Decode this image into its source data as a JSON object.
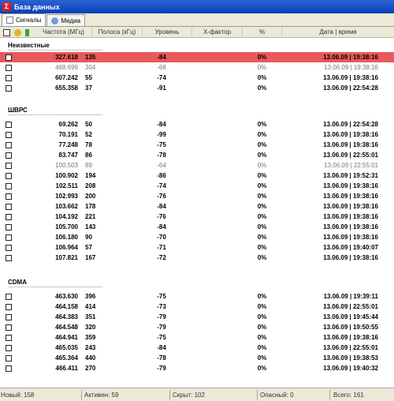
{
  "window": {
    "title": "База данных"
  },
  "tabs": [
    {
      "label": "Сигналы"
    },
    {
      "label": "Медиа"
    }
  ],
  "columns": {
    "freq": "Частота (МГц)",
    "bw": "Полоса (кГц)",
    "level": "Уровень",
    "xfactor": "Х-фактор",
    "pct": "%",
    "datetime": "Дата | время"
  },
  "groups": [
    {
      "name": "Неизвестные",
      "rows": [
        {
          "freq": "327.618",
          "bw": "135",
          "level": "-84",
          "pct": "0%",
          "dt": "13.06.09 | 19:38:16",
          "state": "hl"
        },
        {
          "freq": "468.699",
          "bw": "304",
          "level": "-68",
          "pct": "0%",
          "dt": "13.06.09 | 19:38:16",
          "state": "dim"
        },
        {
          "freq": "607.242",
          "bw": "55",
          "level": "-74",
          "pct": "0%",
          "dt": "13.06.09 | 19:38:16",
          "state": ""
        },
        {
          "freq": "655.358",
          "bw": "37",
          "level": "-91",
          "pct": "0%",
          "dt": "13.06.09 | 22:54:28",
          "state": ""
        }
      ]
    },
    {
      "name": "ШВРС",
      "rows": [
        {
          "freq": "69.262",
          "bw": "50",
          "level": "-84",
          "pct": "0%",
          "dt": "13.06.09 | 22:54:28",
          "state": ""
        },
        {
          "freq": "70.191",
          "bw": "52",
          "level": "-99",
          "pct": "0%",
          "dt": "13.06.09 | 19:38:16",
          "state": ""
        },
        {
          "freq": "77.248",
          "bw": "78",
          "level": "-75",
          "pct": "0%",
          "dt": "13.06.09 | 19:38:16",
          "state": ""
        },
        {
          "freq": "83.747",
          "bw": "86",
          "level": "-78",
          "pct": "0%",
          "dt": "13.06.09 | 22:55:01",
          "state": ""
        },
        {
          "freq": "100.503",
          "bw": "89",
          "level": "-64",
          "pct": "0%",
          "dt": "13.06.09 | 22:55:01",
          "state": "dim"
        },
        {
          "freq": "100.902",
          "bw": "194",
          "level": "-86",
          "pct": "0%",
          "dt": "13.06.09 | 19:52:31",
          "state": ""
        },
        {
          "freq": "102.511",
          "bw": "208",
          "level": "-74",
          "pct": "0%",
          "dt": "13.06.09 | 19:38:16",
          "state": ""
        },
        {
          "freq": "102.993",
          "bw": "200",
          "level": "-76",
          "pct": "0%",
          "dt": "13.06.09 | 19:38:16",
          "state": ""
        },
        {
          "freq": "103.662",
          "bw": "178",
          "level": "-84",
          "pct": "0%",
          "dt": "13.06.09 | 19:38:16",
          "state": ""
        },
        {
          "freq": "104.192",
          "bw": "221",
          "level": "-76",
          "pct": "0%",
          "dt": "13.06.09 | 19:38:16",
          "state": ""
        },
        {
          "freq": "105.700",
          "bw": "143",
          "level": "-84",
          "pct": "0%",
          "dt": "13.06.09 | 19:38:16",
          "state": ""
        },
        {
          "freq": "106.180",
          "bw": "90",
          "level": "-70",
          "pct": "0%",
          "dt": "13.06.09 | 19:38:16",
          "state": ""
        },
        {
          "freq": "106.964",
          "bw": "57",
          "level": "-71",
          "pct": "0%",
          "dt": "13.06.09 | 19:40:07",
          "state": ""
        },
        {
          "freq": "107.821",
          "bw": "167",
          "level": "-72",
          "pct": "0%",
          "dt": "13.06.09 | 19:38:16",
          "state": ""
        }
      ]
    },
    {
      "name": "CDMA",
      "rows": [
        {
          "freq": "463.630",
          "bw": "396",
          "level": "-75",
          "pct": "0%",
          "dt": "13.06.09 | 19:39:11",
          "state": ""
        },
        {
          "freq": "464.158",
          "bw": "414",
          "level": "-73",
          "pct": "0%",
          "dt": "13.06.09 | 22:55:01",
          "state": ""
        },
        {
          "freq": "464.383",
          "bw": "351",
          "level": "-79",
          "pct": "0%",
          "dt": "13.06.09 | 19:45:44",
          "state": ""
        },
        {
          "freq": "464.548",
          "bw": "320",
          "level": "-79",
          "pct": "0%",
          "dt": "13.06.09 | 19:50:55",
          "state": ""
        },
        {
          "freq": "464.941",
          "bw": "359",
          "level": "-75",
          "pct": "0%",
          "dt": "13.06.09 | 19:38:16",
          "state": ""
        },
        {
          "freq": "465.035",
          "bw": "243",
          "level": "-84",
          "pct": "0%",
          "dt": "13.06.09 | 22:55:01",
          "state": ""
        },
        {
          "freq": "465.364",
          "bw": "440",
          "level": "-78",
          "pct": "0%",
          "dt": "13.06.09 | 19:38:53",
          "state": ""
        },
        {
          "freq": "466.411",
          "bw": "270",
          "level": "-79",
          "pct": "0%",
          "dt": "13.06.09 | 19:40:32",
          "state": ""
        }
      ]
    }
  ],
  "status": {
    "new": "Новый: 158",
    "active": "Активен: 59",
    "hidden": "Скрыт: 102",
    "dangerous": "Опасный: 0",
    "total": "Всего: 161"
  },
  "colors": {
    "highlight": "#e8595a",
    "titlebar": "#0b3fb8"
  }
}
